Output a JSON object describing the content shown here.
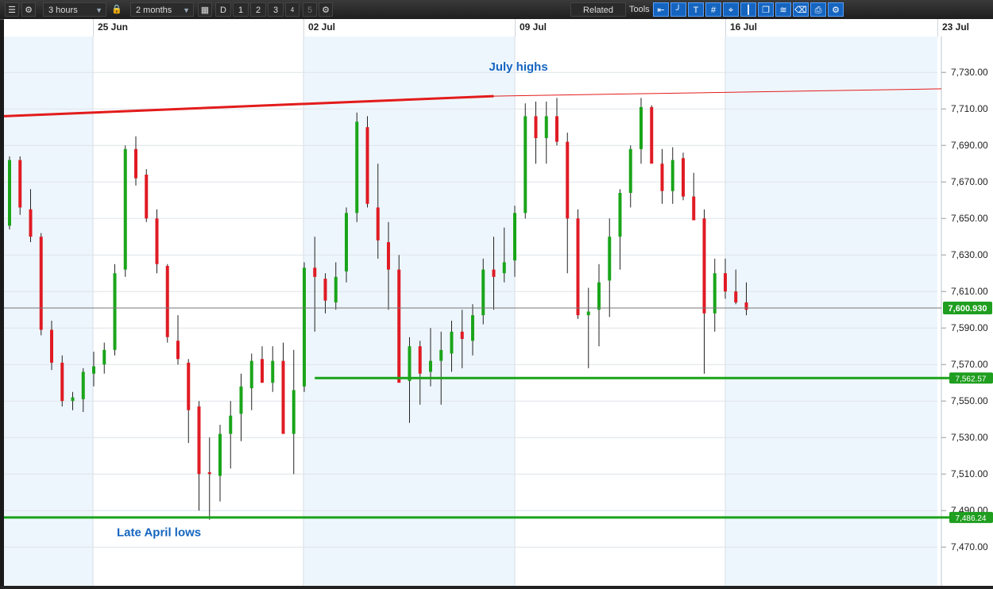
{
  "toolbar": {
    "interval": "3 hours",
    "range": "2 months",
    "period_buttons": [
      "D",
      "1",
      "2",
      "3",
      "4",
      "5"
    ],
    "related_label": "Related",
    "tools_label": "Tools"
  },
  "chart_data": {
    "type": "candlestick",
    "date_labels": [
      "25 Jun",
      "02 Jul",
      "09 Jul",
      "16 Jul",
      "23 Jul"
    ],
    "y_ticks": [
      "7,730.00",
      "7,710.00",
      "7,690.00",
      "7,670.00",
      "7,650.00",
      "7,630.00",
      "7,610.00",
      "7,590.00",
      "7,570.00",
      "7,550.00",
      "7,530.00",
      "7,510.00",
      "7,490.00",
      "7,470.00"
    ],
    "ylim": [
      7455,
      7750
    ],
    "current_price": 7600.93,
    "current_price_label": "7,600.930",
    "levels": [
      {
        "label": "7,562.57",
        "value": 7562.57,
        "color": "#1aa31a",
        "start_session": 29
      },
      {
        "label": "7,486.24",
        "value": 7486.24,
        "color": "#1aa31a",
        "start_session": 0
      }
    ],
    "trendline": {
      "from": [
        0,
        7706
      ],
      "to": [
        46,
        7717
      ],
      "extend_to": 7721,
      "color": "#e31b1b"
    },
    "annotations": [
      {
        "text": "July highs",
        "session": 46,
        "value": 7731
      },
      {
        "text": "Late April lows",
        "session": 8,
        "value": 7476
      }
    ],
    "candles": [
      [
        7646,
        7684,
        7644,
        7682
      ],
      [
        7682,
        7684,
        7652,
        7656
      ],
      [
        7655,
        7666,
        7637,
        7640
      ],
      [
        7640,
        7642,
        7586,
        7589
      ],
      [
        7589,
        7594,
        7567,
        7571
      ],
      [
        7571,
        7575,
        7547,
        7550
      ],
      [
        7550,
        7555,
        7545,
        7552
      ],
      [
        7551,
        7568,
        7544,
        7566
      ],
      [
        7565,
        7577,
        7558,
        7569
      ],
      [
        7570,
        7582,
        7565,
        7578
      ],
      [
        7578,
        7625,
        7575,
        7620
      ],
      [
        7622,
        7690,
        7618,
        7688
      ],
      [
        7688,
        7695,
        7668,
        7672
      ],
      [
        7674,
        7677,
        7648,
        7650
      ],
      [
        7650,
        7655,
        7620,
        7625
      ],
      [
        7624,
        7625,
        7582,
        7585
      ],
      [
        7583,
        7597,
        7570,
        7573
      ],
      [
        7571,
        7573,
        7527,
        7545
      ],
      [
        7547,
        7550,
        7490,
        7510
      ],
      [
        7511,
        7530,
        7485,
        7510
      ],
      [
        7509,
        7537,
        7495,
        7532
      ],
      [
        7532,
        7550,
        7513,
        7542
      ],
      [
        7543,
        7565,
        7528,
        7558
      ],
      [
        7557,
        7576,
        7545,
        7572
      ],
      [
        7573,
        7580,
        7560,
        7560
      ],
      [
        7560,
        7580,
        7555,
        7572
      ],
      [
        7572,
        7582,
        7538,
        7532
      ],
      [
        7532,
        7578,
        7510,
        7556
      ],
      [
        7558,
        7626,
        7555,
        7623
      ],
      [
        7623,
        7640,
        7588,
        7618
      ],
      [
        7617,
        7620,
        7598,
        7605
      ],
      [
        7604,
        7626,
        7600,
        7618
      ],
      [
        7621,
        7656,
        7615,
        7653
      ],
      [
        7653,
        7708,
        7648,
        7703
      ],
      [
        7700,
        7706,
        7656,
        7658
      ],
      [
        7656,
        7680,
        7628,
        7638
      ],
      [
        7637,
        7648,
        7600,
        7622
      ],
      [
        7622,
        7630,
        7570,
        7560
      ],
      [
        7561,
        7585,
        7538,
        7580
      ],
      [
        7580,
        7583,
        7548,
        7565
      ],
      [
        7566,
        7590,
        7558,
        7572
      ],
      [
        7572,
        7588,
        7548,
        7578
      ],
      [
        7576,
        7594,
        7566,
        7588
      ],
      [
        7588,
        7600,
        7568,
        7584
      ],
      [
        7583,
        7603,
        7575,
        7597
      ],
      [
        7597,
        7628,
        7592,
        7622
      ],
      [
        7622,
        7640,
        7600,
        7618
      ],
      [
        7620,
        7645,
        7615,
        7626
      ],
      [
        7627,
        7657,
        7618,
        7653
      ],
      [
        7653,
        7713,
        7650,
        7706
      ],
      [
        7706,
        7714,
        7680,
        7694
      ],
      [
        7694,
        7714,
        7680,
        7706
      ],
      [
        7706,
        7716,
        7690,
        7692
      ],
      [
        7692,
        7697,
        7620,
        7650
      ],
      [
        7650,
        7655,
        7595,
        7597
      ],
      [
        7597,
        7612,
        7568,
        7599
      ],
      [
        7600,
        7625,
        7580,
        7615
      ],
      [
        7616,
        7650,
        7596,
        7640
      ],
      [
        7640,
        7666,
        7622,
        7664
      ],
      [
        7664,
        7690,
        7656,
        7688
      ],
      [
        7688,
        7716,
        7680,
        7711
      ],
      [
        7711,
        7712,
        7688,
        7680
      ],
      [
        7680,
        7688,
        7658,
        7665
      ],
      [
        7665,
        7689,
        7658,
        7682
      ],
      [
        7683,
        7686,
        7660,
        7662
      ],
      [
        7662,
        7675,
        7650,
        7649
      ],
      [
        7650,
        7655,
        7565,
        7598
      ],
      [
        7598,
        7628,
        7588,
        7620
      ],
      [
        7620,
        7628,
        7606,
        7610
      ],
      [
        7610,
        7622,
        7603,
        7604
      ],
      [
        7604,
        7615,
        7597,
        7600
      ]
    ]
  }
}
